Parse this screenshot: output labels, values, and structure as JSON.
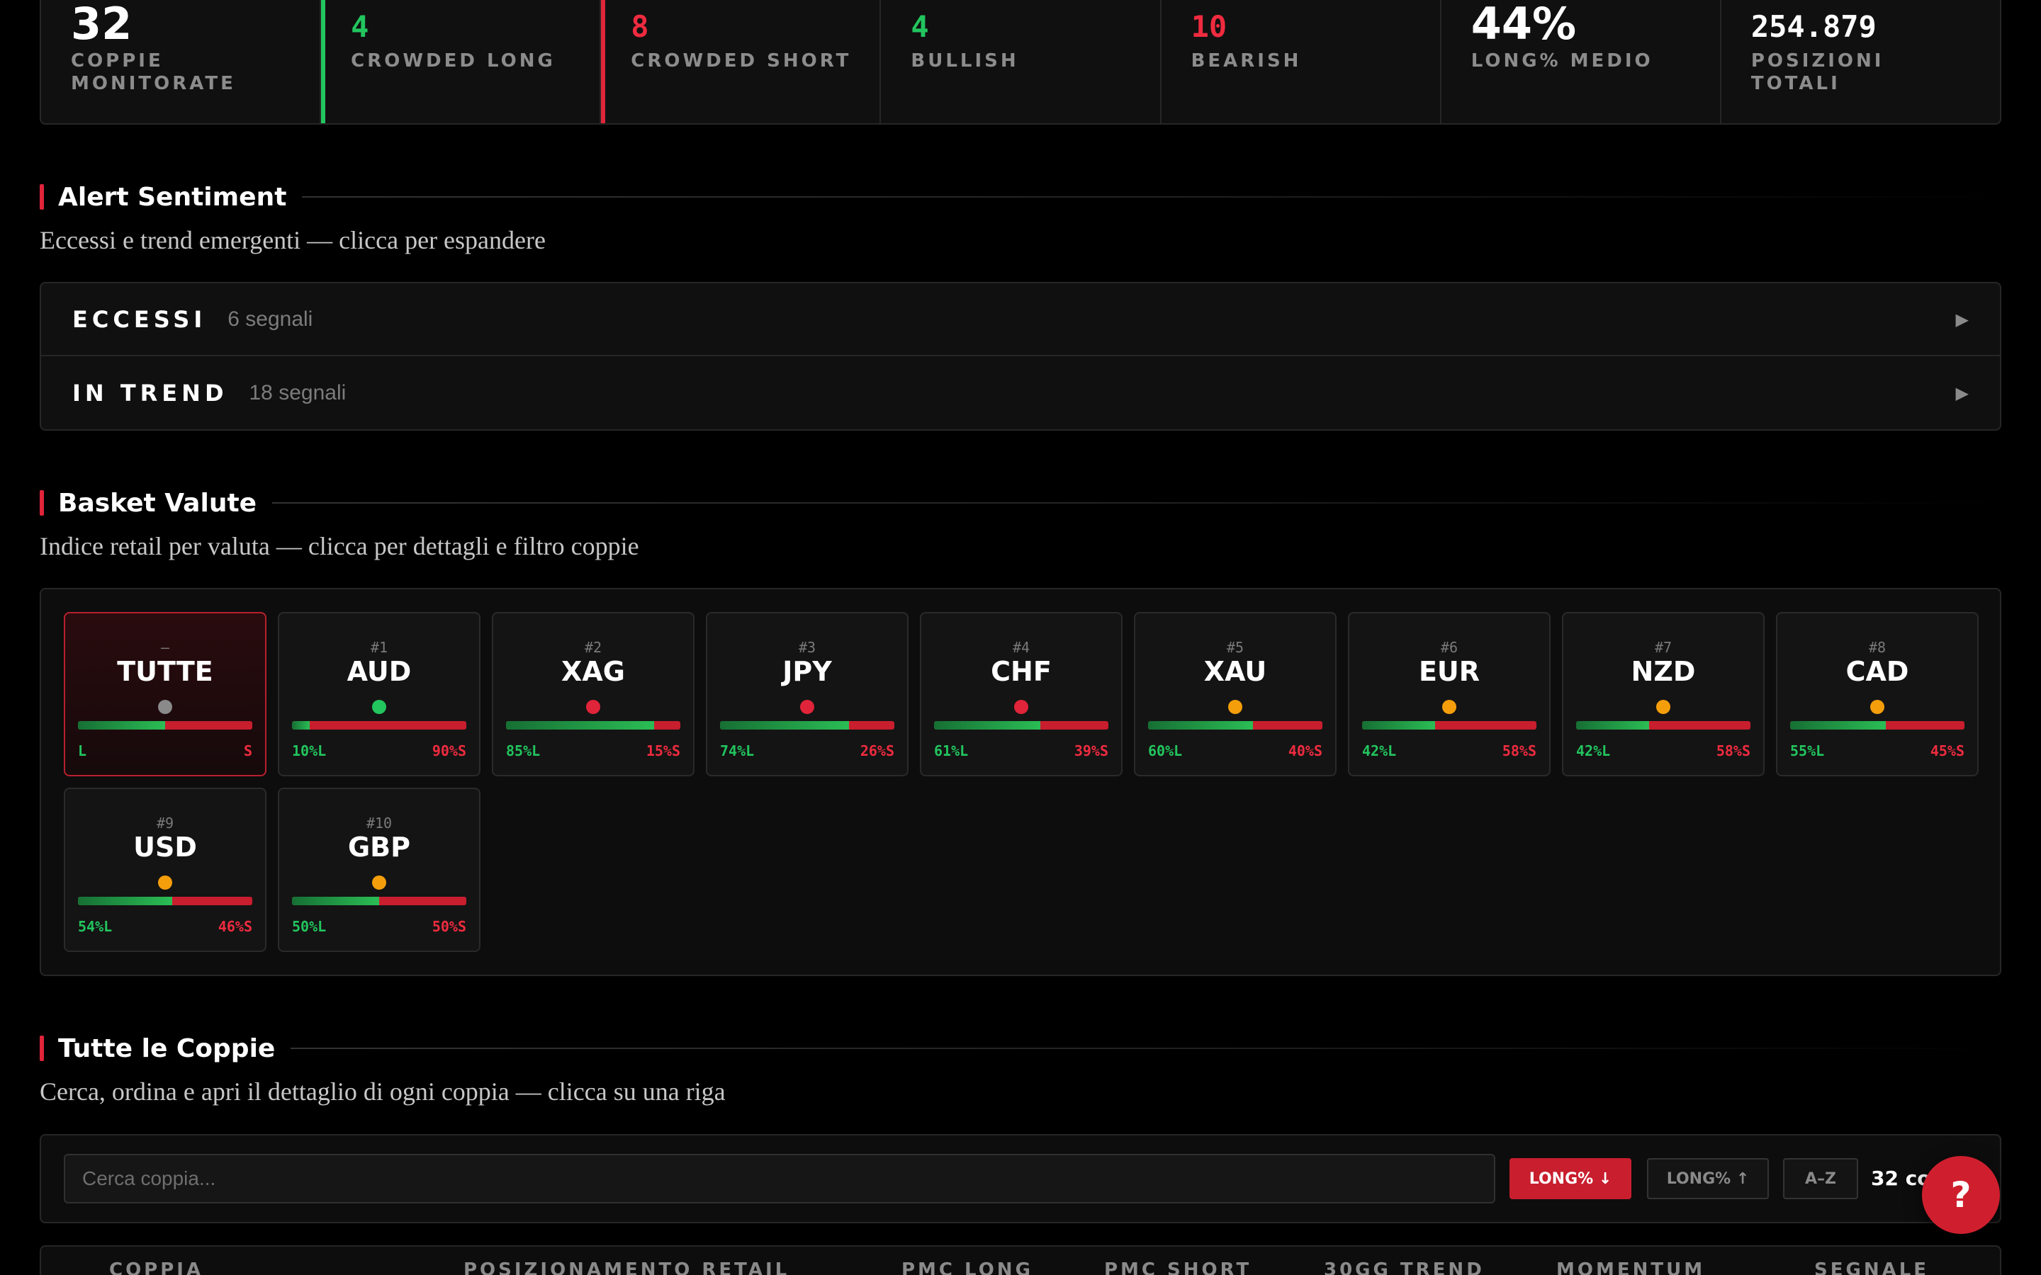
{
  "stats": [
    {
      "value": "32",
      "label": "COPPIE MONITORATE",
      "color": "#ffffff"
    },
    {
      "value": "4",
      "label": "CROWDED LONG",
      "color": "#22c55e"
    },
    {
      "value": "8",
      "label": "CROWDED SHORT",
      "color": "#ef2b3f"
    },
    {
      "value": "4",
      "label": "BULLISH",
      "color": "#22c55e"
    },
    {
      "value": "10",
      "label": "BEARISH",
      "color": "#ef2b3f"
    },
    {
      "value": "44%",
      "label": "LONG% MEDIO",
      "color": "#ffffff"
    },
    {
      "value": "254.879",
      "label": "POSIZIONI TOTALI",
      "color": "#ffffff"
    }
  ],
  "alerts": {
    "title": "Alert Sentiment",
    "subtitle": "Eccessi e trend emergenti — clicca per espandere",
    "rows": [
      {
        "title": "ECCESSI",
        "count": "6 segnali",
        "arrow": "▶"
      },
      {
        "title": "IN TREND",
        "count": "18 segnali",
        "arrow": "▶"
      }
    ]
  },
  "basket": {
    "title": "Basket Valute",
    "subtitle": "Indice retail per valuta — clicca per dettagli e filtro coppie",
    "cards": [
      {
        "rank": "–",
        "currency": "TUTTE",
        "long_pct": 50,
        "long_label": "L",
        "short_label": "S",
        "dot_color": "#8a8a8a",
        "active": true
      },
      {
        "rank": "#1",
        "currency": "AUD",
        "long_pct": 10,
        "long_label": "10%L",
        "short_label": "90%S",
        "dot_color": "#22c55e"
      },
      {
        "rank": "#2",
        "currency": "XAG",
        "long_pct": 85,
        "long_label": "85%L",
        "short_label": "15%S",
        "dot_color": "#e0243a"
      },
      {
        "rank": "#3",
        "currency": "JPY",
        "long_pct": 74,
        "long_label": "74%L",
        "short_label": "26%S",
        "dot_color": "#e0243a"
      },
      {
        "rank": "#4",
        "currency": "CHF",
        "long_pct": 61,
        "long_label": "61%L",
        "short_label": "39%S",
        "dot_color": "#e0243a"
      },
      {
        "rank": "#5",
        "currency": "XAU",
        "long_pct": 60,
        "long_label": "60%L",
        "short_label": "40%S",
        "dot_color": "#f59e0b"
      },
      {
        "rank": "#6",
        "currency": "EUR",
        "long_pct": 42,
        "long_label": "42%L",
        "short_label": "58%S",
        "dot_color": "#f59e0b"
      },
      {
        "rank": "#7",
        "currency": "NZD",
        "long_pct": 42,
        "long_label": "42%L",
        "short_label": "58%S",
        "dot_color": "#f59e0b"
      },
      {
        "rank": "#8",
        "currency": "CAD",
        "long_pct": 55,
        "long_label": "55%L",
        "short_label": "45%S",
        "dot_color": "#f59e0b"
      },
      {
        "rank": "#9",
        "currency": "USD",
        "long_pct": 54,
        "long_label": "54%L",
        "short_label": "46%S",
        "dot_color": "#f59e0b"
      },
      {
        "rank": "#10",
        "currency": "GBP",
        "long_pct": 50,
        "long_label": "50%L",
        "short_label": "50%S",
        "dot_color": "#f59e0b"
      }
    ]
  },
  "pairs": {
    "title": "Tutte le Coppie",
    "subtitle": "Cerca, ordina e apri il dettaglio di ogni coppia — clicca su una riga",
    "search_placeholder": "Cerca coppia...",
    "sort_buttons": [
      {
        "label": "LONG% ↓",
        "active": true
      },
      {
        "label": "LONG% ↑",
        "active": false
      },
      {
        "label": "A–Z",
        "active": false
      }
    ],
    "count": "32 co",
    "help": "?",
    "columns": [
      "COPPIA",
      "POSIZIONAMENTO RETAIL",
      "PMC LONG",
      "PMC SHORT",
      "30GG TREND",
      "MOMENTUM",
      "SEGNALE"
    ]
  }
}
